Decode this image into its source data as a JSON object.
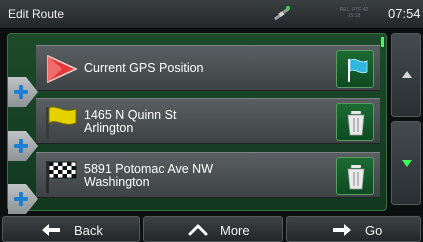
{
  "status_bar": {
    "title": "Edit Route",
    "gps_status": "REL. FTF 42 15:18",
    "clock": "07:54",
    "icons": [
      "satellite-icon"
    ]
  },
  "route": {
    "items": [
      {
        "label_line1": "Current GPS Position",
        "label_line2": "",
        "icon": "start-flag-icon",
        "action_icon": "set-start-flag-icon"
      },
      {
        "label_line1": "1465 N Quinn St",
        "label_line2": "Arlington",
        "icon": "waypoint-flag-icon",
        "action_icon": "trash-icon"
      },
      {
        "label_line1": "5891 Potomac Ave NW",
        "label_line2": "Washington",
        "icon": "checkered-flag-icon",
        "action_icon": "trash-icon"
      }
    ],
    "insert_icon": "plus-icon"
  },
  "scroll": {
    "up_icon": "arrow-up-icon",
    "down_icon": "arrow-down-icon"
  },
  "footer": {
    "back_label": "Back",
    "more_label": "More",
    "go_label": "Go"
  },
  "colors": {
    "accent_green": "#3cff5a",
    "plus_blue": "#1d7fd3",
    "start_flag_red": "#e23a3a",
    "waypoint_flag_yellow": "#e6d200",
    "action_flag_cyan": "#2fb7e0"
  }
}
